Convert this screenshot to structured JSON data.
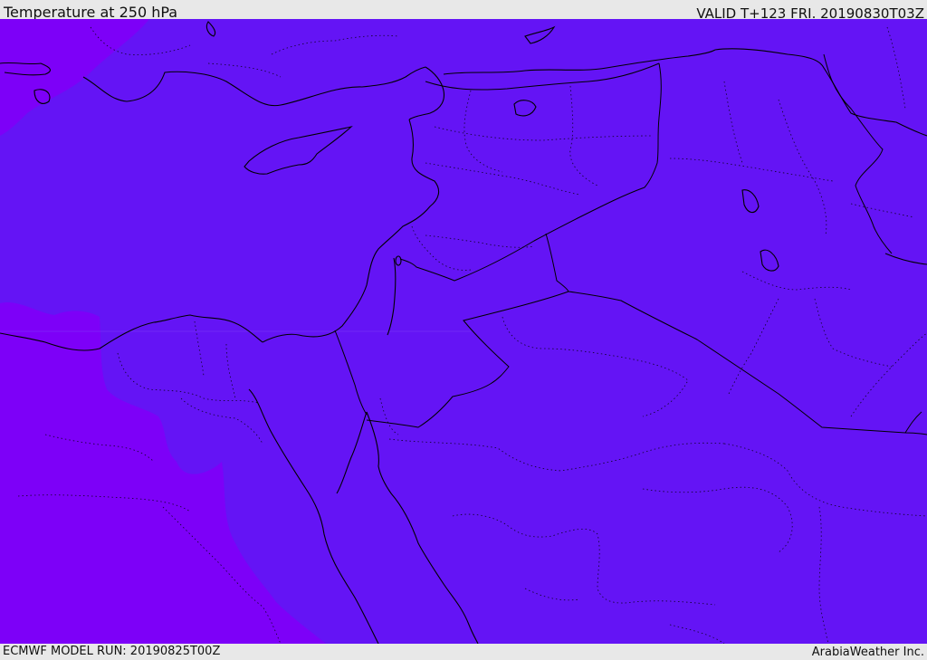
{
  "header": {
    "title": "Temperature at 250 hPa",
    "valid": "VALID T+123 FRI. 20190830T03Z"
  },
  "footer": {
    "model_run": "ECMWF MODEL RUN: 20190825T00Z",
    "credit": "ArabiaWeather Inc."
  },
  "colors": {
    "base_fill": "#6414f5",
    "warm_fill": "#7d00f8",
    "coastline": "#000000",
    "borders": "#000000",
    "background": "#e8e8e8"
  },
  "map": {
    "variable": "temperature",
    "level": "250 hPa",
    "region": "Eastern Mediterranean and Middle East"
  }
}
